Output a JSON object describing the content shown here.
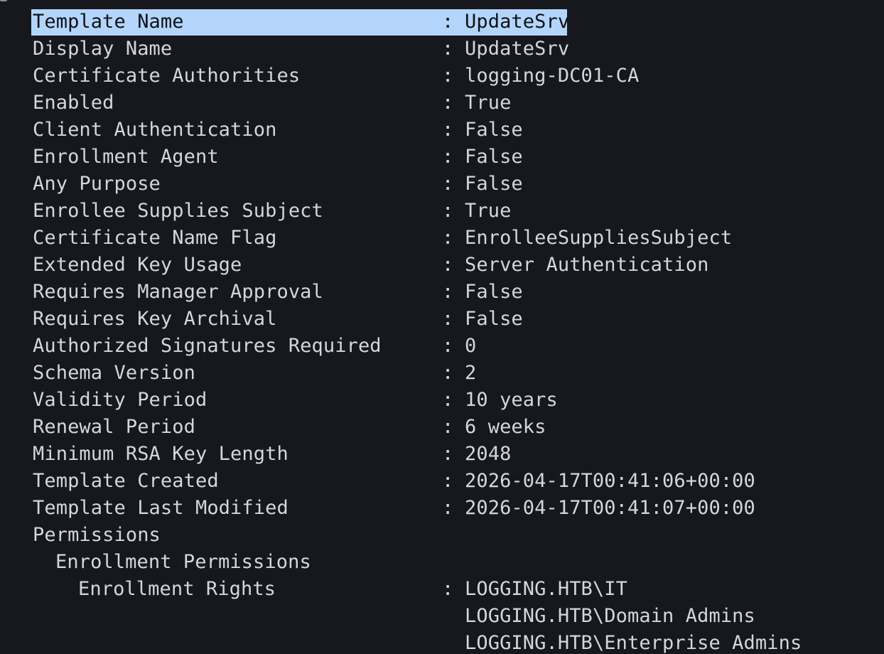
{
  "selection_color": "#b4d5fb",
  "background_color": "#16181d",
  "text_color": "#d4d6da",
  "rows": [
    {
      "label": "Template Name",
      "sep": ":",
      "value": "UpdateSrv",
      "indent": 0,
      "selected": true
    },
    {
      "label": "Display Name",
      "sep": ":",
      "value": "UpdateSrv",
      "indent": 0
    },
    {
      "label": "Certificate Authorities",
      "sep": ":",
      "value": "logging-DC01-CA",
      "indent": 0
    },
    {
      "label": "Enabled",
      "sep": ":",
      "value": "True",
      "indent": 0
    },
    {
      "label": "Client Authentication",
      "sep": ":",
      "value": "False",
      "indent": 0
    },
    {
      "label": "Enrollment Agent",
      "sep": ":",
      "value": "False",
      "indent": 0
    },
    {
      "label": "Any Purpose",
      "sep": ":",
      "value": "False",
      "indent": 0
    },
    {
      "label": "Enrollee Supplies Subject",
      "sep": ":",
      "value": "True",
      "indent": 0
    },
    {
      "label": "Certificate Name Flag",
      "sep": ":",
      "value": "EnrolleeSuppliesSubject",
      "indent": 0
    },
    {
      "label": "Extended Key Usage",
      "sep": ":",
      "value": "Server Authentication",
      "indent": 0
    },
    {
      "label": "Requires Manager Approval",
      "sep": ":",
      "value": "False",
      "indent": 0
    },
    {
      "label": "Requires Key Archival",
      "sep": ":",
      "value": "False",
      "indent": 0
    },
    {
      "label": "Authorized Signatures Required",
      "sep": ":",
      "value": "0",
      "indent": 0
    },
    {
      "label": "Schema Version",
      "sep": ":",
      "value": "2",
      "indent": 0
    },
    {
      "label": "Validity Period",
      "sep": ":",
      "value": "10 years",
      "indent": 0
    },
    {
      "label": "Renewal Period",
      "sep": ":",
      "value": "6 weeks",
      "indent": 0
    },
    {
      "label": "Minimum RSA Key Length",
      "sep": ":",
      "value": "2048",
      "indent": 0
    },
    {
      "label": "Template Created",
      "sep": ":",
      "value": "2026-04-17T00:41:06+00:00",
      "indent": 0
    },
    {
      "label": "Template Last Modified",
      "sep": ":",
      "value": "2026-04-17T00:41:07+00:00",
      "indent": 0
    },
    {
      "label": "Permissions",
      "sep": "",
      "value": "",
      "indent": 0
    },
    {
      "label": "Enrollment Permissions",
      "sep": "",
      "value": "",
      "indent": 1
    },
    {
      "label": "Enrollment Rights",
      "sep": ":",
      "value": "LOGGING.HTB\\IT",
      "indent": 2
    },
    {
      "label": "",
      "sep": "",
      "value": "LOGGING.HTB\\Domain Admins",
      "indent": 0
    },
    {
      "label": "",
      "sep": "",
      "value": "LOGGING.HTB\\Enterprise Admins",
      "indent": 0
    }
  ]
}
